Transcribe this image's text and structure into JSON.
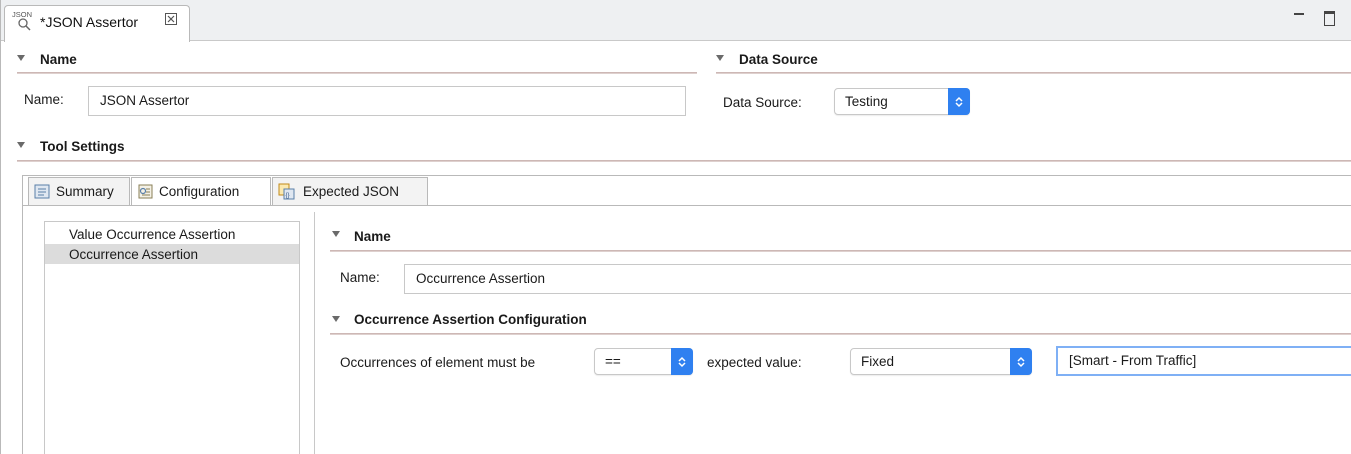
{
  "editor": {
    "tab_title": "*JSON Assertor",
    "icon": "json-assertor-icon",
    "close_icon": "close-tab-icon"
  },
  "name_section": {
    "title": "Name",
    "label": "Name:",
    "value": "JSON Assertor"
  },
  "data_source_section": {
    "title": "Data Source",
    "label": "Data Source:",
    "selected": "Testing"
  },
  "tool_settings": {
    "title": "Tool Settings",
    "tabs": [
      {
        "label": "Summary",
        "icon": "summary-icon"
      },
      {
        "label": "Configuration",
        "icon": "configuration-icon"
      },
      {
        "label": "Expected JSON",
        "icon": "expected-json-icon"
      }
    ]
  },
  "assertions_list": {
    "items": [
      {
        "label": "Value Occurrence Assertion"
      },
      {
        "label": "Occurrence Assertion"
      }
    ]
  },
  "assertion_detail": {
    "name_title": "Name",
    "name_label": "Name:",
    "name_value": "Occurrence Assertion",
    "config_title": "Occurrence Assertion Configuration",
    "occurrences_label": "Occurrences of element must be",
    "operator": "==",
    "expected_label": "expected value:",
    "expected_mode": "Fixed",
    "expected_value": "[Smart - From Traffic]"
  },
  "colors": {
    "accent": "#2f80f0",
    "section_rule": "#c4aba8",
    "selected_row": "#dcdcdc"
  }
}
